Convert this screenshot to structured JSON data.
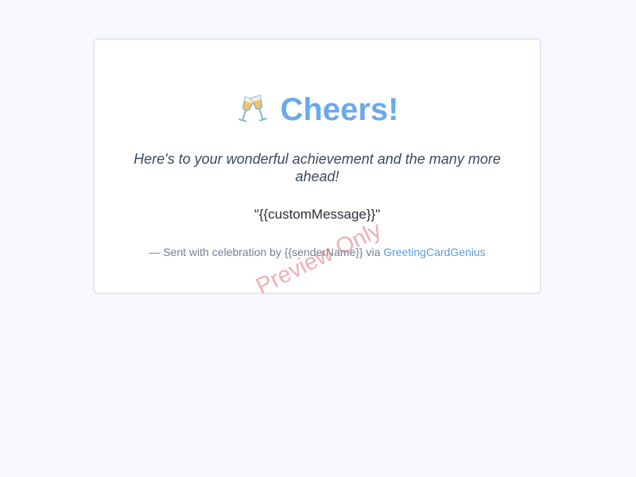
{
  "card": {
    "title": "Cheers!",
    "icon": "clinking-glasses-icon",
    "subtitle": "Here's to your wonderful achievement and the many more ahead!",
    "custom_message": "\"{{customMessage}}\"",
    "footer": {
      "prefix": "— Sent with celebration by {{senderName}} via ",
      "link_label": "GreetingCardGenius"
    },
    "watermark": "Preview Only"
  },
  "colors": {
    "page_background": "#f7f9fc",
    "card_border": "#e1e8f1",
    "title": "#6aa9ec",
    "link": "#5b9de0",
    "watermark": "#e6787d"
  }
}
